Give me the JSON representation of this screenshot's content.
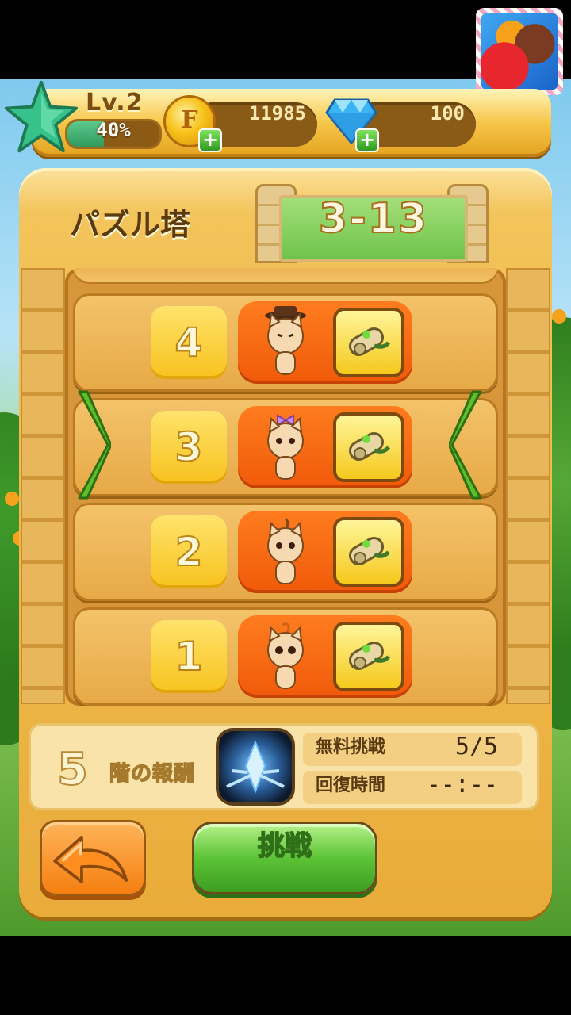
{
  "hud": {
    "level_label": "Lv.2",
    "xp_percent_text": "40%",
    "xp_fraction": 0.4,
    "coins": "11985",
    "gems": "100",
    "coin_symbol": "F",
    "plus_symbol": "+"
  },
  "tower": {
    "title": "パズル塔",
    "floor": "3-13",
    "floors": [
      {
        "number": "4",
        "enemy": "cat-with-hat-icon",
        "reward": "scroll-icon"
      },
      {
        "number": "3",
        "enemy": "cat-with-bow-icon",
        "reward": "scroll-icon",
        "selected": true
      },
      {
        "number": "2",
        "enemy": "cat-icon",
        "reward": "scroll-icon"
      },
      {
        "number": "1",
        "enemy": "cat-icon",
        "reward": "scroll-icon"
      }
    ]
  },
  "reward": {
    "floor_count": "5",
    "label": "階の報酬",
    "icon": "ice-crystal-icon"
  },
  "stats": {
    "free_label": "無料挑戦",
    "free_value": "5/5",
    "recover_label": "回復時間",
    "recover_value": "--:--"
  },
  "buttons": {
    "challenge": "挑戦",
    "back_icon": "back-arrow-icon"
  },
  "colors": {
    "panel": "#f3c45b",
    "enemy_box": "#f05a0a",
    "challenge": "#5cc336",
    "floor_box": "#6cc24a"
  }
}
